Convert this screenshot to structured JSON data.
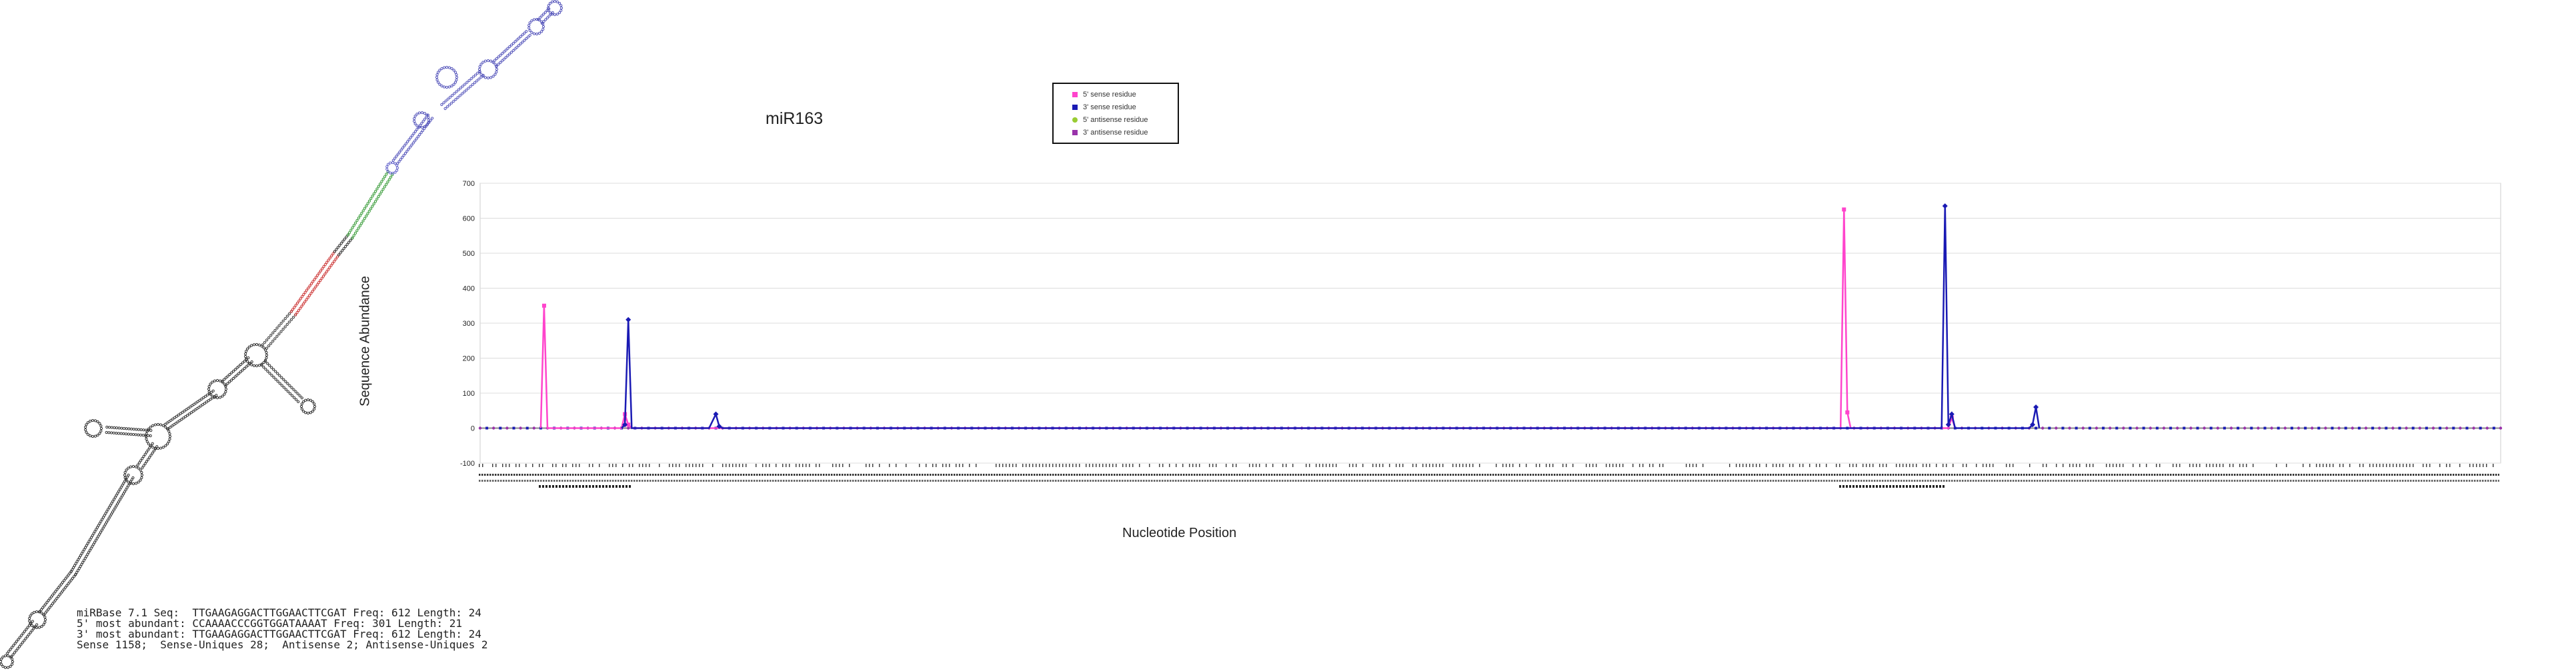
{
  "title": "miR163",
  "legend": [
    {
      "label": "5' sense residue",
      "color": "#ff44cc",
      "marker": "square"
    },
    {
      "label": "3' sense residue",
      "color": "#1a1ab4",
      "marker": "diamond"
    },
    {
      "label": "5' antisense residue",
      "color": "#99cc33",
      "marker": "circle"
    },
    {
      "label": "3' antisense residue",
      "color": "#9933aa",
      "marker": "square"
    }
  ],
  "info": {
    "line1": "miRBase 7.1 Seq:  TTGAAGAGGACTTGGAACTTCGAT Freq: 612 Length: 24",
    "line2": "5' most abundant: CCAAAACCCGGTGGATAAAAT Freq: 301 Length: 21",
    "line3": "3' most abundant: TTGAAGAGGACTTGGAACTTCGAT Freq: 612 Length: 24",
    "line4": "Sense 1158;  Sense-Uniques 28;  Antisense 2; Antisense-Uniques 2"
  },
  "chart_data": {
    "type": "line",
    "title": "miR163",
    "xlabel": "Nucleotide Position",
    "ylabel": "Sequence Abundance",
    "ylim": [
      -100,
      700
    ],
    "yticks": [
      -100,
      0,
      100,
      200,
      300,
      400,
      500,
      600,
      700
    ],
    "grid": true,
    "xlim": [
      0,
      300
    ],
    "series": [
      {
        "name": "5' sense residue",
        "color": "#ff44cc",
        "points": [
          [
            9,
            0
          ],
          [
            9.5,
            350
          ],
          [
            10,
            0
          ],
          [
            21,
            0
          ],
          [
            21.5,
            40
          ],
          [
            22,
            10
          ],
          [
            22.5,
            0
          ],
          [
            202,
            0
          ],
          [
            202.5,
            625
          ],
          [
            203,
            45
          ],
          [
            203.5,
            0
          ],
          [
            218,
            0
          ],
          [
            218.5,
            30
          ],
          [
            219,
            0
          ]
        ]
      },
      {
        "name": "3' sense residue",
        "color": "#1a1ab4",
        "points": [
          [
            21,
            0
          ],
          [
            21.5,
            10
          ],
          [
            22,
            310
          ],
          [
            22.5,
            0
          ],
          [
            34,
            0
          ],
          [
            35,
            40
          ],
          [
            35.5,
            5
          ],
          [
            36,
            0
          ],
          [
            217,
            0
          ],
          [
            217.5,
            635
          ],
          [
            218,
            10
          ],
          [
            218.5,
            40
          ],
          [
            219,
            0
          ],
          [
            230,
            0
          ],
          [
            230.5,
            10
          ],
          [
            231,
            60
          ],
          [
            231.5,
            0
          ]
        ]
      },
      {
        "name": "3' antisense residue",
        "color": "#9933aa",
        "points": [
          [
            0,
            0
          ],
          [
            300,
            0
          ]
        ]
      }
    ]
  }
}
